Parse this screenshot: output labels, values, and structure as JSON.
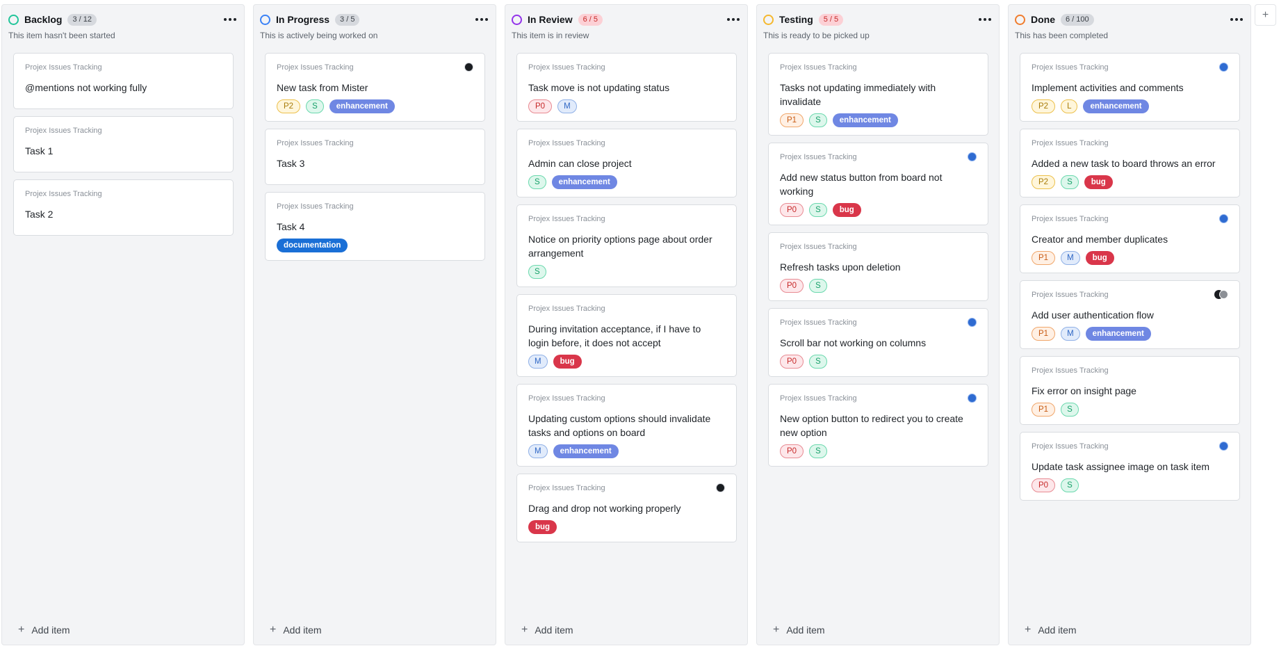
{
  "colors": {
    "backlog": "#22c59a",
    "in_progress": "#3b82f6",
    "in_review": "#9333ea",
    "testing": "#f5b82e",
    "done": "#f07d2e",
    "enhancement": "#6f87e3",
    "bug": "#d9364a",
    "documentation": "#1a6fd6"
  },
  "add_item_label": "Add item",
  "add_column_label": "+",
  "columns": [
    {
      "title": "Backlog",
      "count": "3 / 12",
      "description": "This item hasn't been started",
      "cards": [
        {
          "project": "Projex Issues Tracking",
          "title": "@mentions not working fully",
          "tags": []
        },
        {
          "project": "Projex Issues Tracking",
          "title": "Task 1",
          "tags": []
        },
        {
          "project": "Projex Issues Tracking",
          "title": "Task 2",
          "tags": []
        }
      ]
    },
    {
      "title": "In Progress",
      "count": "3 / 5",
      "description": "This is actively being worked on",
      "cards": [
        {
          "project": "Projex Issues Tracking",
          "title": "New task from Mister",
          "avatar": "dark",
          "tags": [
            {
              "text": "P2",
              "kind": "p2"
            },
            {
              "text": "S",
              "kind": "size"
            },
            {
              "text": "enhancement",
              "kind": "enhancement"
            }
          ]
        },
        {
          "project": "Projex Issues Tracking",
          "title": "Task 3",
          "tags": []
        },
        {
          "project": "Projex Issues Tracking",
          "title": "Task 4",
          "tags": [
            {
              "text": "documentation",
              "kind": "documentation"
            }
          ]
        }
      ]
    },
    {
      "title": "In Review",
      "count": "6 / 5",
      "description": "This item is in review",
      "cards": [
        {
          "project": "Projex Issues Tracking",
          "title": "Task move is not updating status",
          "tags": [
            {
              "text": "P0",
              "kind": "p0"
            },
            {
              "text": "M",
              "kind": "sizeM"
            }
          ]
        },
        {
          "project": "Projex Issues Tracking",
          "title": "Admin can close project",
          "tags": [
            {
              "text": "S",
              "kind": "size"
            },
            {
              "text": "enhancement",
              "kind": "enhancement"
            }
          ]
        },
        {
          "project": "Projex Issues Tracking",
          "title": "Notice on priority options page about order arrangement",
          "tags": [
            {
              "text": "S",
              "kind": "size"
            }
          ]
        },
        {
          "project": "Projex Issues Tracking",
          "title": "During invitation acceptance, if I have to login before, it does not accept",
          "tags": [
            {
              "text": "M",
              "kind": "sizeM"
            },
            {
              "text": "bug",
              "kind": "bug"
            }
          ]
        },
        {
          "project": "Projex Issues Tracking",
          "title": "Updating custom options should invalidate tasks and options on board",
          "tags": [
            {
              "text": "M",
              "kind": "sizeM"
            },
            {
              "text": "enhancement",
              "kind": "enhancement"
            }
          ]
        },
        {
          "project": "Projex Issues Tracking",
          "title": "Drag and drop not working properly",
          "avatar": "dark",
          "tags": [
            {
              "text": "bug",
              "kind": "bug"
            }
          ]
        }
      ]
    },
    {
      "title": "Testing",
      "count": "5 / 5",
      "description": "This is ready to be picked up",
      "cards": [
        {
          "project": "Projex Issues Tracking",
          "title": "Tasks not updating immediately with invalidate",
          "tags": [
            {
              "text": "P1",
              "kind": "p1"
            },
            {
              "text": "S",
              "kind": "size"
            },
            {
              "text": "enhancement",
              "kind": "enhancement"
            }
          ]
        },
        {
          "project": "Projex Issues Tracking",
          "title": "Add new status button from board not working",
          "avatar": "blue",
          "tags": [
            {
              "text": "P0",
              "kind": "p0"
            },
            {
              "text": "S",
              "kind": "size"
            },
            {
              "text": "bug",
              "kind": "bug"
            }
          ]
        },
        {
          "project": "Projex Issues Tracking",
          "title": "Refresh tasks upon deletion",
          "tags": [
            {
              "text": "P0",
              "kind": "p0"
            },
            {
              "text": "S",
              "kind": "size"
            }
          ]
        },
        {
          "project": "Projex Issues Tracking",
          "title": "Scroll bar not working on columns",
          "avatar": "blue",
          "tags": [
            {
              "text": "P0",
              "kind": "p0"
            },
            {
              "text": "S",
              "kind": "size"
            }
          ]
        },
        {
          "project": "Projex Issues Tracking",
          "title": "New option button to redirect you to create new option",
          "avatar": "blue",
          "tags": [
            {
              "text": "P0",
              "kind": "p0"
            },
            {
              "text": "S",
              "kind": "size"
            }
          ]
        }
      ]
    },
    {
      "title": "Done",
      "count": "6 / 100",
      "description": "This has been completed",
      "cards": [
        {
          "project": "Projex Issues Tracking",
          "title": "Implement activities and comments",
          "avatar": "blue",
          "tags": [
            {
              "text": "P2",
              "kind": "p2"
            },
            {
              "text": "L",
              "kind": "sizeL"
            },
            {
              "text": "enhancement",
              "kind": "enhancement"
            }
          ]
        },
        {
          "project": "Projex Issues Tracking",
          "title": "Added a new task to board throws an error",
          "tags": [
            {
              "text": "P2",
              "kind": "p2"
            },
            {
              "text": "S",
              "kind": "size"
            },
            {
              "text": "bug",
              "kind": "bug"
            }
          ]
        },
        {
          "project": "Projex Issues Tracking",
          "title": "Creator and member duplicates",
          "avatar": "blue",
          "tags": [
            {
              "text": "P1",
              "kind": "p1"
            },
            {
              "text": "M",
              "kind": "sizeM"
            },
            {
              "text": "bug",
              "kind": "bug"
            }
          ]
        },
        {
          "project": "Projex Issues Tracking",
          "title": "Add user authentication flow",
          "avatar": "pair",
          "tags": [
            {
              "text": "P1",
              "kind": "p1"
            },
            {
              "text": "M",
              "kind": "sizeM"
            },
            {
              "text": "enhancement",
              "kind": "enhancement"
            }
          ]
        },
        {
          "project": "Projex Issues Tracking",
          "title": "Fix error on insight page",
          "tags": [
            {
              "text": "P1",
              "kind": "p1"
            },
            {
              "text": "S",
              "kind": "size"
            }
          ]
        },
        {
          "project": "Projex Issues Tracking",
          "title": "Update task assignee image on task item",
          "avatar": "blue",
          "tags": [
            {
              "text": "P0",
              "kind": "p0"
            },
            {
              "text": "S",
              "kind": "size"
            }
          ]
        }
      ]
    }
  ]
}
